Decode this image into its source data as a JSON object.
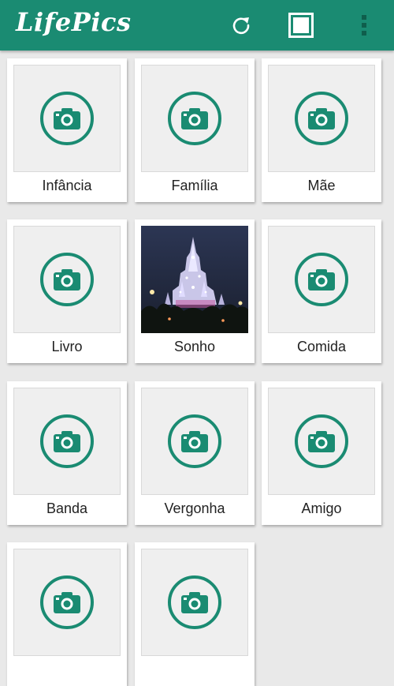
{
  "app": {
    "title": "LifePics",
    "accent_color": "#1a8b72"
  },
  "toolbar": {
    "icons": [
      "refresh-icon",
      "square-frame-icon",
      "overflow-menu-icon"
    ]
  },
  "cards": [
    {
      "label": "Infância",
      "has_photo": false,
      "icon": "camera-icon"
    },
    {
      "label": "Família",
      "has_photo": false,
      "icon": "camera-icon"
    },
    {
      "label": "Mãe",
      "has_photo": false,
      "icon": "camera-icon"
    },
    {
      "label": "Livro",
      "has_photo": false,
      "icon": "camera-icon"
    },
    {
      "label": "Sonho",
      "has_photo": true,
      "icon": "castle-photo"
    },
    {
      "label": "Comida",
      "has_photo": false,
      "icon": "camera-icon"
    },
    {
      "label": "Banda",
      "has_photo": false,
      "icon": "camera-icon"
    },
    {
      "label": "Vergonha",
      "has_photo": false,
      "icon": "camera-icon"
    },
    {
      "label": "Amigo",
      "has_photo": false,
      "icon": "camera-icon"
    },
    {
      "label": "",
      "has_photo": false,
      "icon": "camera-icon"
    },
    {
      "label": "",
      "has_photo": false,
      "icon": "camera-icon"
    }
  ]
}
